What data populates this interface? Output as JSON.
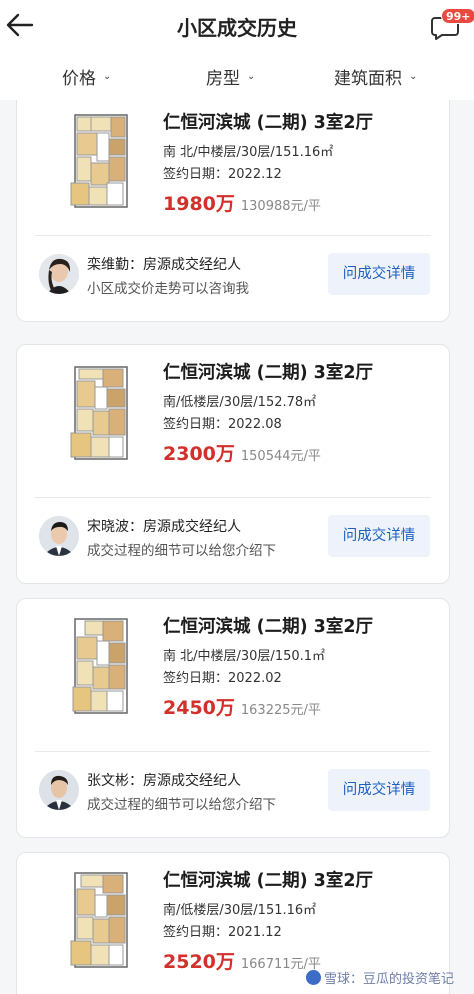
{
  "header": {
    "title": "小区成交历史",
    "badge": "99+"
  },
  "filters": [
    {
      "label": "价格"
    },
    {
      "label": "房型"
    },
    {
      "label": "建筑面积"
    }
  ],
  "records": [
    {
      "title": "仁恒河滨城 (二期) 3室2厅",
      "meta": "南 北/中楼层/30层/151.16㎡",
      "date": "签约日期：2022.12",
      "total": "1980万",
      "unit_price": "130988元/平",
      "agent": "栾维勤：房源成交经纪人",
      "tip": "小区成交价走势可以咨询我",
      "button": "问成交详情"
    },
    {
      "title": "仁恒河滨城 (二期) 3室2厅",
      "meta": "南/低楼层/30层/152.78㎡",
      "date": "签约日期：2022.08",
      "total": "2300万",
      "unit_price": "150544元/平",
      "agent": "宋晓波：房源成交经纪人",
      "tip": "成交过程的细节可以给您介绍下",
      "button": "问成交详情"
    },
    {
      "title": "仁恒河滨城 (二期) 3室2厅",
      "meta": "南 北/中楼层/30层/150.1㎡",
      "date": "签约日期：2022.02",
      "total": "2450万",
      "unit_price": "163225元/平",
      "agent": "张文彬：房源成交经纪人",
      "tip": "成交过程的细节可以给您介绍下",
      "button": "问成交详情"
    },
    {
      "title": "仁恒河滨城 (二期) 3室2厅",
      "meta": "南/低楼层/30层/151.16㎡",
      "date": "签约日期：2021.12",
      "total": "2520万",
      "unit_price": "166711元/平"
    }
  ],
  "watermark": "雪球：豆瓜的投资笔记",
  "colors": {
    "price_red": "#d2302b",
    "button_blue": "#1f5fbf",
    "badge_red": "#e9493e"
  }
}
